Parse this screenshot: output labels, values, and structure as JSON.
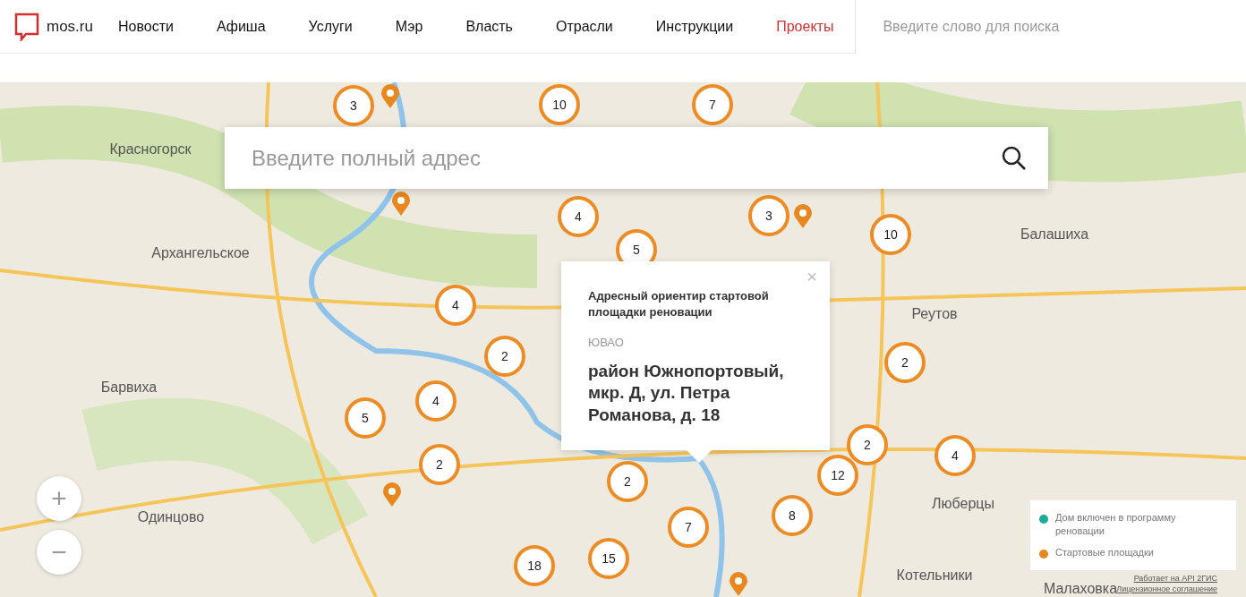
{
  "header": {
    "logo": "mos.ru",
    "nav": [
      {
        "label": "Новости",
        "selected": false
      },
      {
        "label": "Афиша",
        "selected": false
      },
      {
        "label": "Услуги",
        "selected": false
      },
      {
        "label": "Мэр",
        "selected": false
      },
      {
        "label": "Власть",
        "selected": false
      },
      {
        "label": "Отрасли",
        "selected": false
      },
      {
        "label": "Инструкции",
        "selected": false
      },
      {
        "label": "Проекты",
        "selected": true
      }
    ],
    "search": {
      "placeholder": "Введите слово для поиска"
    }
  },
  "map": {
    "address_search": {
      "placeholder": "Введите полный адрес"
    },
    "map_labels": [
      {
        "text": "Красногорск"
      },
      {
        "text": "Архангельское"
      },
      {
        "text": "Балашиха"
      },
      {
        "text": "Реутов"
      },
      {
        "text": "Барвиха"
      },
      {
        "text": "Одинцово"
      },
      {
        "text": "Люберцы"
      },
      {
        "text": "Котельники"
      },
      {
        "text": "Малаховка"
      }
    ],
    "clusters": [
      {
        "count": "3"
      },
      {
        "count": "10"
      },
      {
        "count": "7"
      },
      {
        "count": "4"
      },
      {
        "count": "5"
      },
      {
        "count": "3"
      },
      {
        "count": "10"
      },
      {
        "count": "4"
      },
      {
        "count": "2"
      },
      {
        "count": "2"
      },
      {
        "count": "4"
      },
      {
        "count": "5"
      },
      {
        "count": "2"
      },
      {
        "count": "2"
      },
      {
        "count": "2"
      },
      {
        "count": "12"
      },
      {
        "count": "4"
      },
      {
        "count": "7"
      },
      {
        "count": "8"
      },
      {
        "count": "15"
      },
      {
        "count": "18"
      }
    ],
    "popup": {
      "title": "Адресный ориентир стартовой площадки реновации",
      "district": "ЮВАО",
      "address": "район Южнопортовый, мкр. Д, ул. Петра Романова, д. 18",
      "close": "×"
    },
    "zoom": {
      "in": "+",
      "out": "−"
    },
    "legend": [
      {
        "label": "Дом включен в программу реновации",
        "color": "#1aab9b"
      },
      {
        "label": "Стартовые площадки",
        "color": "#e8871e"
      }
    ],
    "attribution": [
      "Работает на API 2ГИС",
      "Лицензионное соглашение"
    ]
  }
}
